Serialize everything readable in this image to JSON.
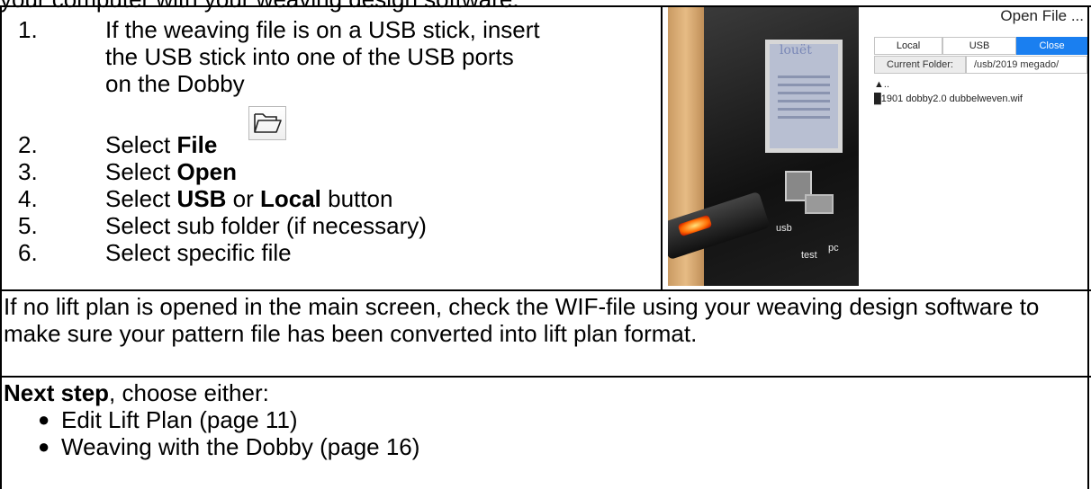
{
  "header": {
    "cut_line": "your computer with your weaving design software."
  },
  "steps": [
    {
      "num": "1.",
      "line1": "If the weaving file is on a USB stick, insert",
      "line2": "the USB stick into one of the USB ports",
      "line3": "on the Dobby"
    },
    {
      "num": "2.",
      "pre": "Select ",
      "bold": "File"
    },
    {
      "num": "3.",
      "pre": "Select ",
      "bold": "Open"
    },
    {
      "num": "4.",
      "pre": "Select ",
      "bold": "USB",
      "mid": " or ",
      "bold2": "Local",
      "post": " button"
    },
    {
      "num": "5.",
      "text": "Select sub folder (if necessary)"
    },
    {
      "num": "6.",
      "text": "Select specific file"
    }
  ],
  "photo": {
    "logo": "louët",
    "usb_label": "usb",
    "test_label": "test",
    "pc_label": "pc"
  },
  "dialog": {
    "title": "Open File ...",
    "buttons": {
      "local": "Local",
      "usb": "USB",
      "close": "Close"
    },
    "folder_label": "Current Folder:",
    "folder_path": "/usb/2019 megado/",
    "parent_entry": "..",
    "file_entry": "1901 dobby2.0 dubbelweven.wif"
  },
  "note": "If no lift plan is opened in the main screen, check the WIF-file using your weaving design software to make sure your pattern file has been converted into lift plan format.",
  "next": {
    "bold": "Next step",
    "rest": ", choose either:",
    "items": [
      "Edit Lift Plan (page 11)",
      "Weaving with the Dobby (page 16)"
    ]
  }
}
